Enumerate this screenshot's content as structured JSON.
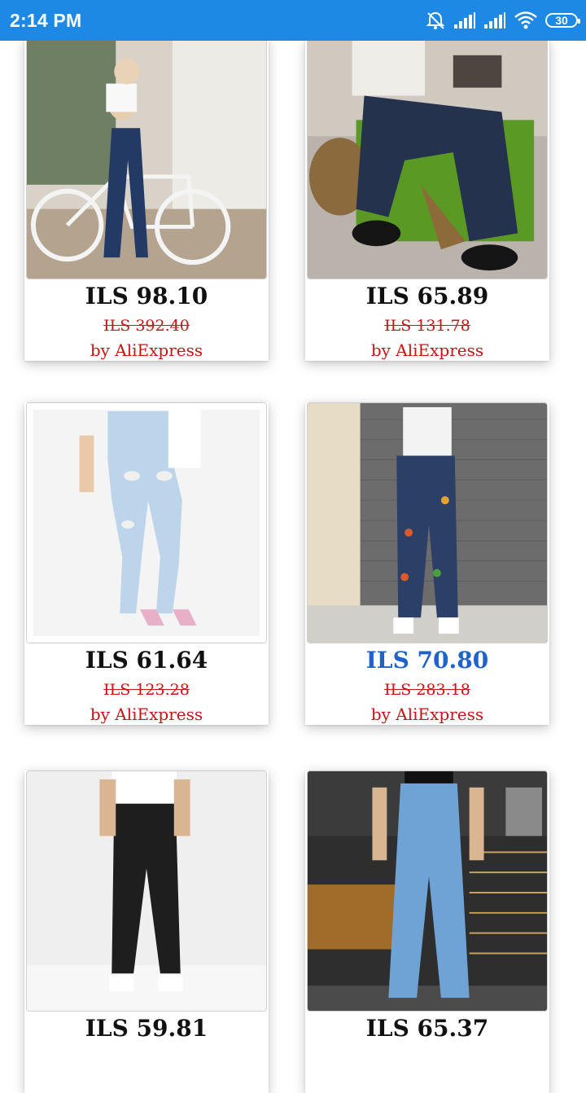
{
  "status_bar": {
    "time": "2:14 PM",
    "battery": "30",
    "icons": [
      "alarm-off-icon",
      "signal-icon",
      "signal-icon",
      "wifi-icon",
      "battery-icon"
    ]
  },
  "colors": {
    "status_bar": "#1e88e5",
    "strike_red": "#c81414",
    "highlight_blue": "#1f63c9"
  },
  "products": [
    {
      "price": "ILS 98.10",
      "old_price": "ILS 392.40",
      "seller": "by AliExpress",
      "highlight": false,
      "image": "woman-with-bicycle-jeans"
    },
    {
      "price": "ILS 65.89",
      "old_price": "ILS 131.78",
      "seller": "by AliExpress",
      "highlight": false,
      "image": "flare-jeans-leopard-slit"
    },
    {
      "price": "ILS 61.64",
      "old_price": "ILS 123.28",
      "seller": "by AliExpress",
      "highlight": false,
      "image": "ripped-light-skinny-jeans"
    },
    {
      "price": "ILS 70.80",
      "old_price": "ILS 283.18",
      "seller": "by AliExpress",
      "highlight": true,
      "image": "butterfly-patch-jeans"
    },
    {
      "price": "ILS 59.81",
      "old_price": "",
      "seller": "",
      "highlight": false,
      "image": "black-straight-jeans"
    },
    {
      "price": "ILS 65.37",
      "old_price": "",
      "seller": "",
      "highlight": false,
      "image": "light-wide-leg-jeans"
    }
  ]
}
